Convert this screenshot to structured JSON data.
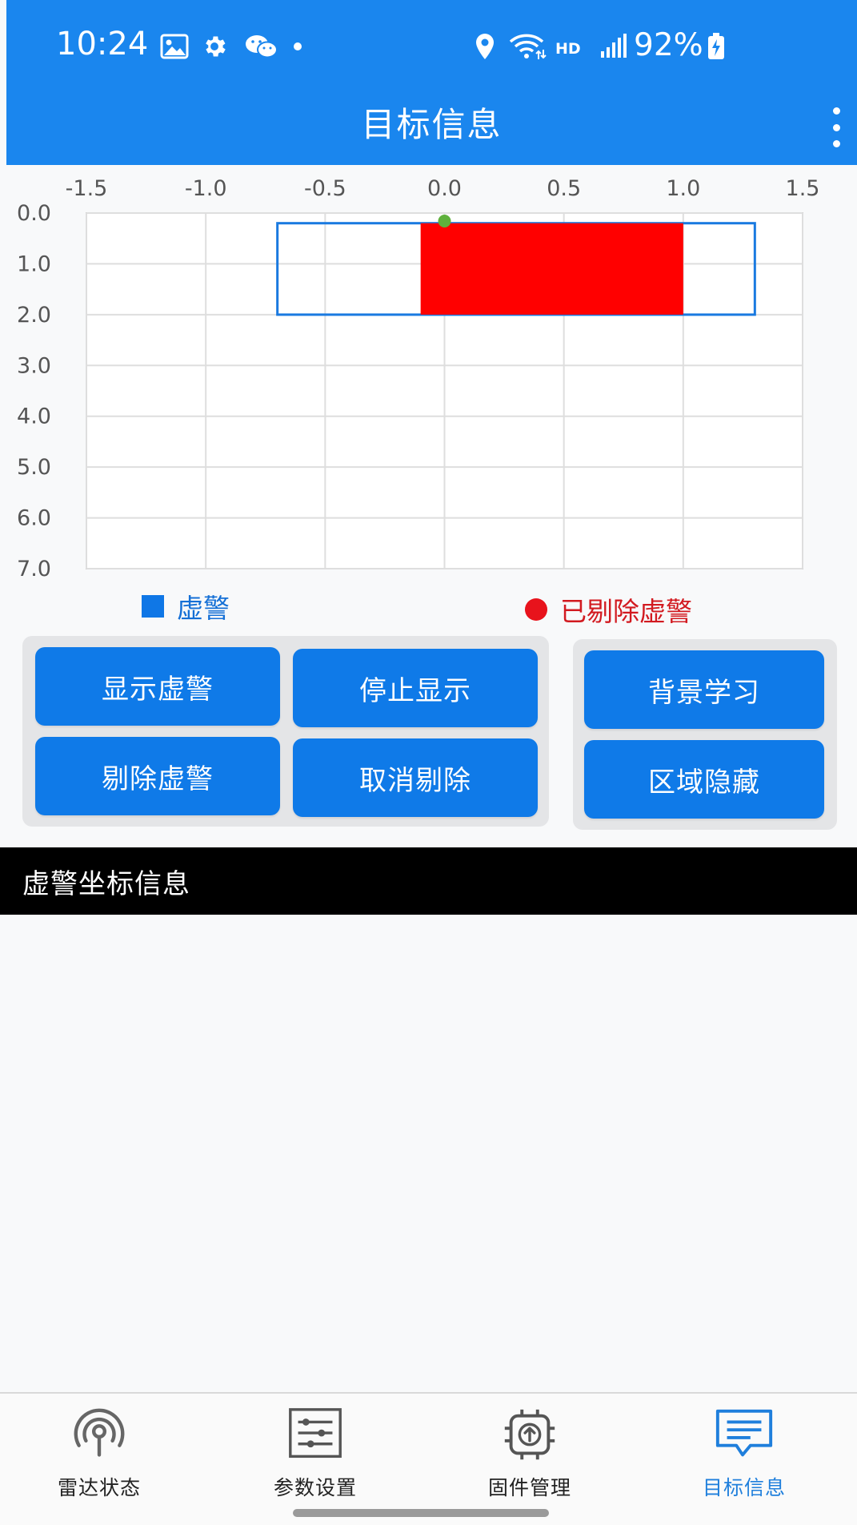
{
  "status_bar": {
    "time": "10:24",
    "network": "HD",
    "battery": "92%",
    "icons": [
      "gallery-icon",
      "settings-icon",
      "wechat-icon",
      "location-icon",
      "wifi-icon",
      "signal-icon",
      "battery-charging-icon"
    ]
  },
  "app_bar": {
    "title": "目标信息",
    "menu_icon": "more-vert-icon"
  },
  "chart_data": {
    "type": "scatter",
    "x_ticks": [
      "-1.5",
      "-1.0",
      "-0.5",
      "0.0",
      "0.5",
      "1.0",
      "1.5"
    ],
    "y_ticks": [
      "0.0",
      "1.0",
      "2.0",
      "3.0",
      "4.0",
      "5.0",
      "6.0",
      "7.0"
    ],
    "xlim": [
      -1.5,
      1.5
    ],
    "ylim": [
      0,
      7
    ],
    "y_inverted": true,
    "x_axis_position": "top",
    "grid": true,
    "points": [
      {
        "x": 0.0,
        "y": 0.0,
        "color": "#5fb13c"
      }
    ],
    "regions": [
      {
        "kind": "outline",
        "x": [
          -0.7,
          1.3
        ],
        "y": [
          0.2,
          2.0
        ],
        "color": "#1a7ae0"
      },
      {
        "kind": "filled",
        "x": [
          -0.1,
          1.0
        ],
        "y": [
          0.2,
          2.0
        ],
        "color": "#ff0000"
      }
    ],
    "legend": [
      {
        "label": "虚警",
        "marker": "square",
        "color": "#0f77e6"
      },
      {
        "label": "已剔除虚警",
        "marker": "circle",
        "color": "#e8131c"
      }
    ]
  },
  "buttons": {
    "show_false_alarm": "显示虚警",
    "stop_display": "停止显示",
    "remove_false_alarm": "剔除虚警",
    "cancel_remove": "取消剔除",
    "background_learning": "背景学习",
    "area_hide": "区域隐藏"
  },
  "section": {
    "title": "虚警坐标信息"
  },
  "bottom_nav": {
    "items": [
      {
        "label": "雷达状态",
        "icon": "radar-icon"
      },
      {
        "label": "参数设置",
        "icon": "sliders-icon"
      },
      {
        "label": "固件管理",
        "icon": "chip-upload-icon"
      },
      {
        "label": "目标信息",
        "icon": "message-icon"
      }
    ],
    "active_index": 3,
    "active_color": "#1f7fdc"
  }
}
